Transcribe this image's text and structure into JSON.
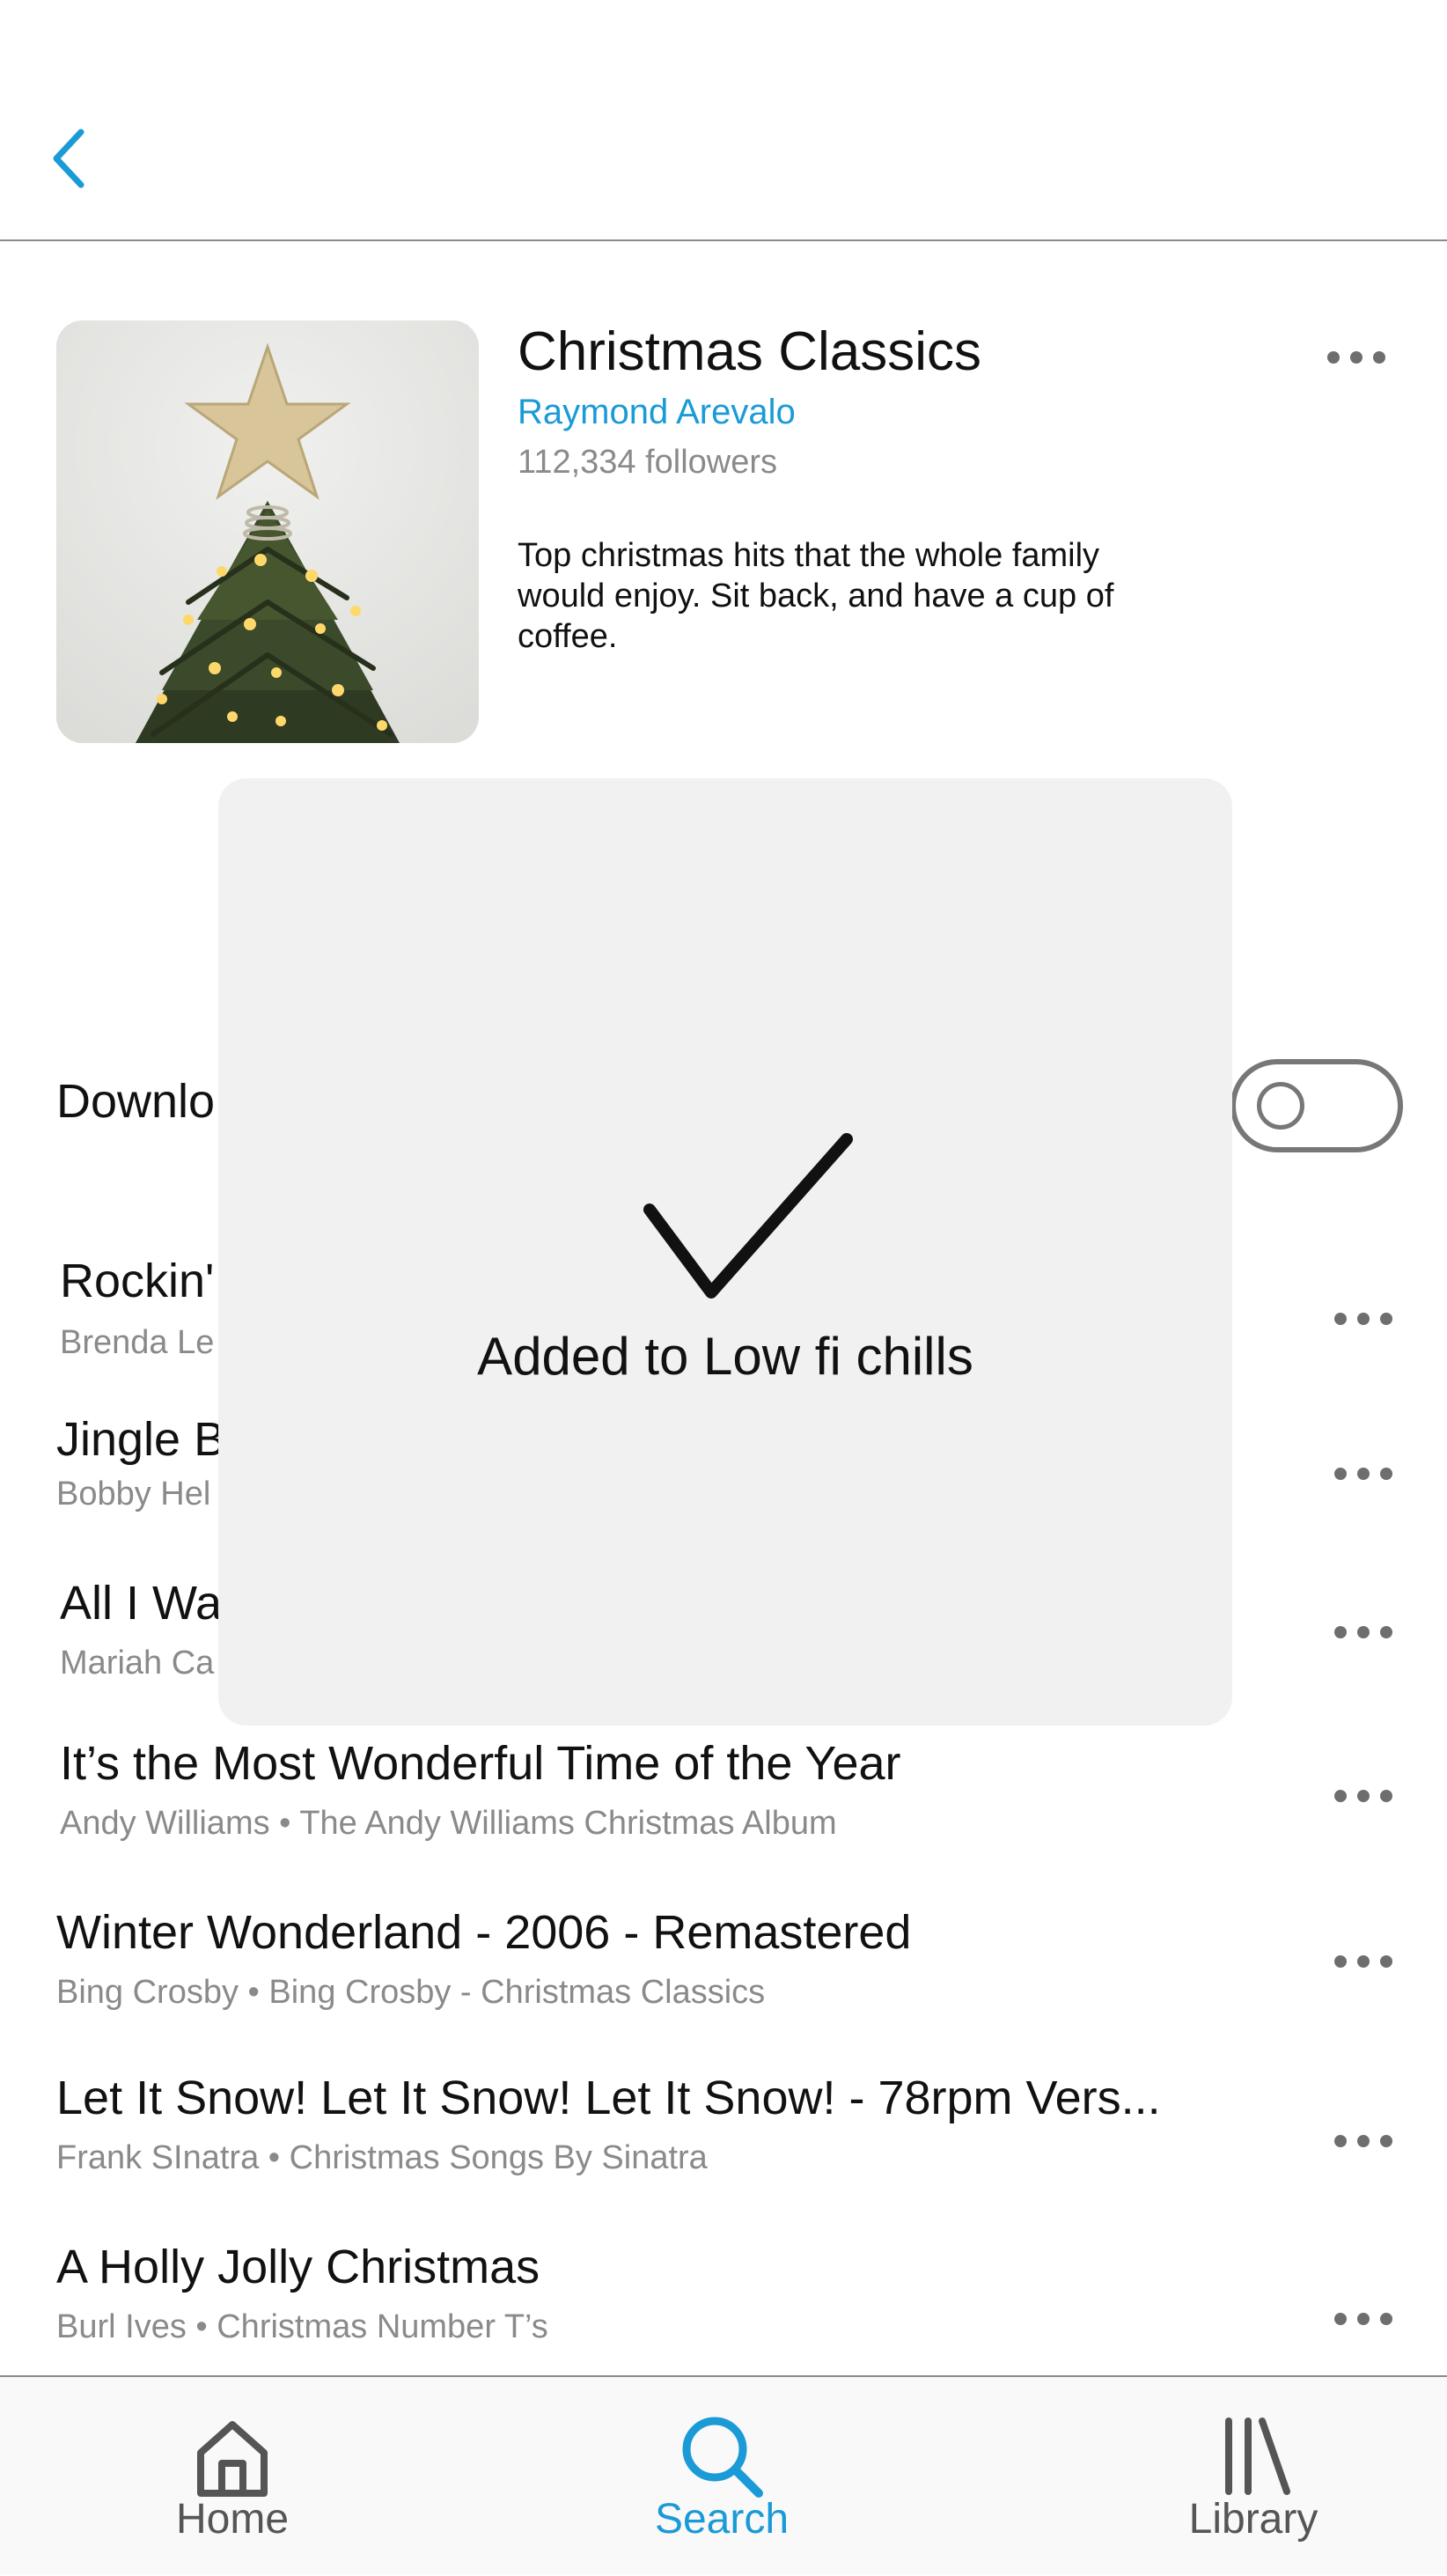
{
  "playlist": {
    "title": "Christmas Classics",
    "owner": "Raymond Arevalo",
    "followers": "112,334 followers",
    "description": "Top christmas hits that the whole family would enjoy.  Sit back, and have a cup of coffee."
  },
  "download": {
    "label": "Downlo",
    "enabled": false
  },
  "tracks": [
    {
      "title": "Rockin'",
      "subtitle": "Brenda Le"
    },
    {
      "title": "Jingle B",
      "subtitle": "Bobby Hel"
    },
    {
      "title": "All I Wa",
      "subtitle": "Mariah Ca"
    },
    {
      "title": "It’s the Most Wonderful Time of the Year",
      "subtitle": "Andy Williams • The Andy Williams Christmas Album"
    },
    {
      "title": "Winter Wonderland - 2006 - Remastered",
      "subtitle": "Bing Crosby • Bing Crosby - Christmas Classics"
    },
    {
      "title": "Let It Snow! Let It Snow! Let It Snow! - 78rpm Vers...",
      "subtitle": "Frank SInatra • Christmas Songs By Sinatra"
    },
    {
      "title": "A Holly Jolly Christmas",
      "subtitle": "Burl Ives • Christmas Number T’s"
    }
  ],
  "overlay": {
    "message": "Added to Low fi chills",
    "icon": "checkmark-icon"
  },
  "tabbar": {
    "home": "Home",
    "search": "Search",
    "library": "Library",
    "active": "search"
  },
  "colors": {
    "accent": "#1a9ad6",
    "muted": "#8a8a8a",
    "overlay_bg": "#f1f1f1",
    "icon_gray": "#555555"
  }
}
